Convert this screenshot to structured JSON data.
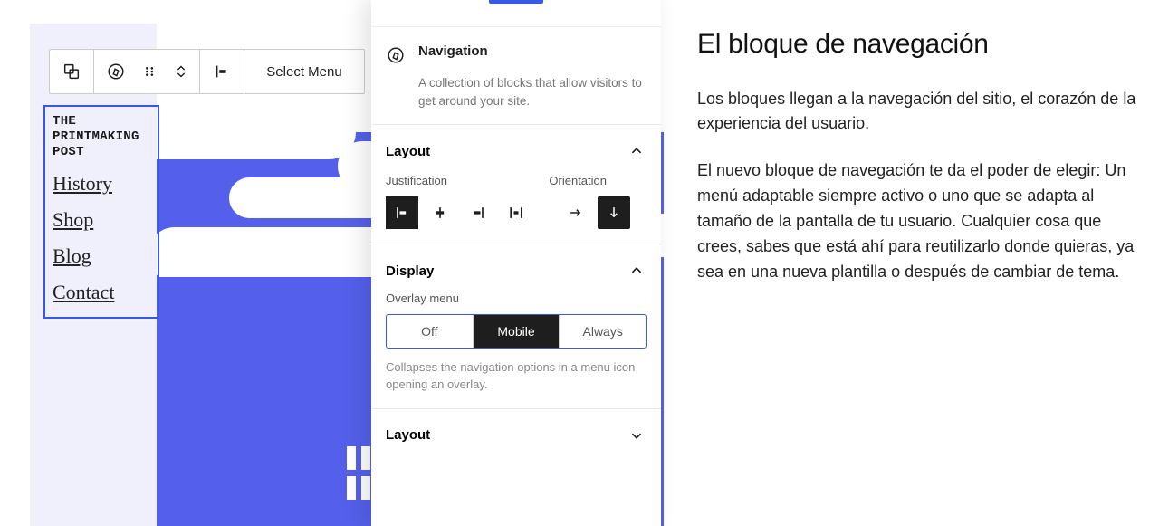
{
  "article": {
    "heading": "El bloque de navegación",
    "p1": "Los bloques llegan a la navegación del sitio, el corazón de la experiencia del usuario.",
    "p2": "El nuevo bloque de navegación te da el poder de elegir: Un menú adaptable siempre activo o uno que se adapta al tamaño de la pantalla de tu usuario. Cualquier cosa que crees, sabes que está ahí para reutilizarlo donde quieras, ya sea en una nueva plantilla o después de cambiar de tema."
  },
  "toolbar": {
    "select_menu": "Select Menu"
  },
  "nav_block": {
    "site_title": "THE PRINTMAKING POST",
    "items": [
      "History",
      "Shop",
      "Blog",
      "Contact"
    ]
  },
  "sidebar": {
    "block": {
      "title": "Navigation",
      "desc": "A collection of blocks that allow visitors to get around your site."
    },
    "layout": {
      "title": "Layout",
      "justification_label": "Justification",
      "orientation_label": "Orientation"
    },
    "display": {
      "title": "Display",
      "overlay_label": "Overlay menu",
      "options": {
        "off": "Off",
        "mobile": "Mobile",
        "always": "Always"
      },
      "help": "Collapses the navigation options in a menu icon opening an overlay."
    },
    "layout2": {
      "title": "Layout"
    }
  }
}
